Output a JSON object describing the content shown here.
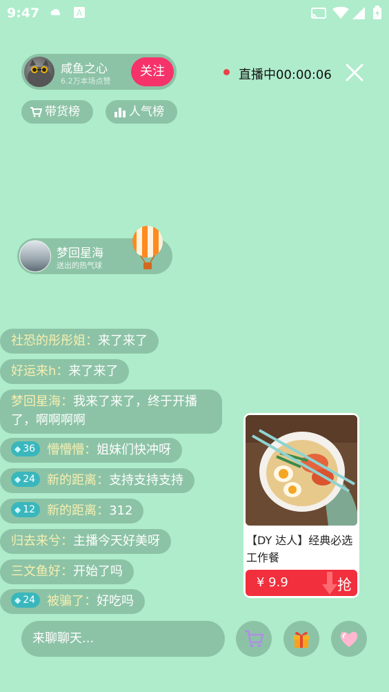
{
  "status_bar": {
    "time": "9:47",
    "icons": [
      "cloud-icon",
      "a-icon",
      "cast-icon",
      "wifi-icon",
      "signal-icon",
      "battery-icon"
    ]
  },
  "host": {
    "name": "咸鱼之心",
    "likes": "6.2万本场点赞",
    "follow_label": "关注"
  },
  "live": {
    "status": "直播中00:00:06"
  },
  "rank": {
    "goods_label": "带货榜",
    "popular_label": "人气榜"
  },
  "gift_notice": {
    "user": "梦回星海",
    "desc": "送出的热气球"
  },
  "chat": [
    {
      "user": "社恐的彤彤姐",
      "sep": "：",
      "text": "来了来了"
    },
    {
      "user": "好运来h",
      "sep": "：",
      "text": "来了来了"
    },
    {
      "user": "梦回星海",
      "sep": "：",
      "text": "我来了来了，终于开播了，啊啊啊啊"
    },
    {
      "badge": "36",
      "user": "懵懵懵",
      "sep": "：",
      "text": "姐妹们快冲呀"
    },
    {
      "badge": "24",
      "user": "新的距离",
      "sep": "：",
      "text": "支持支持支持"
    },
    {
      "badge": "12",
      "user": "新的距离",
      "sep": "：",
      "text": "312"
    },
    {
      "user": "归去来兮",
      "sep": "：",
      "text": "主播今天好美呀"
    },
    {
      "user": "三文鱼好",
      "sep": "：",
      "text": "开始了吗"
    },
    {
      "badge": "24",
      "user": "被骗了",
      "sep": "：",
      "text": "好吃吗"
    }
  ],
  "product": {
    "title": "【DY 达人】经典必选工作餐",
    "price": "¥ 9.9",
    "grab_label": "抢"
  },
  "bottom": {
    "input_placeholder": "来聊聊天..."
  },
  "colors": {
    "background": "#aeeccb",
    "panel": "#8cc3a6",
    "follow": "#f5336a",
    "buy": "#f22f3c",
    "username": "#f7efb0",
    "badge": "#3ab7bd"
  }
}
